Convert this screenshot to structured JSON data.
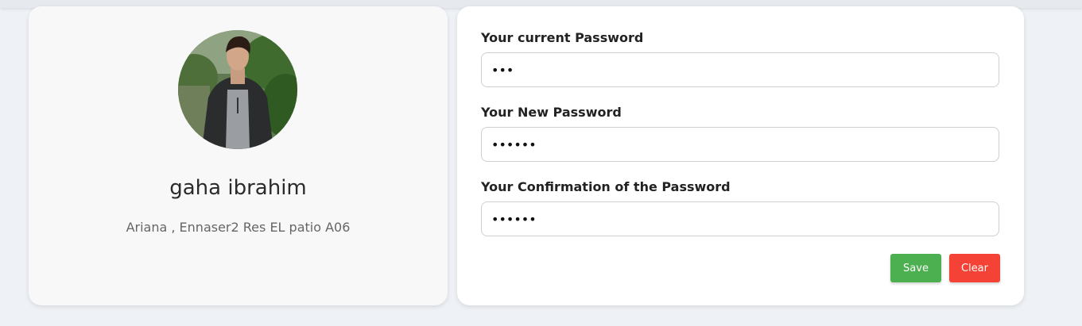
{
  "profile": {
    "name": "gaha ibrahim",
    "address": "Ariana , Ennaser2 Res EL patio A06"
  },
  "password_form": {
    "current": {
      "label": "Your current Password",
      "value": "abc"
    },
    "new": {
      "label": "Your New Password",
      "value": "abcdef"
    },
    "confirm": {
      "label": "Your Confirmation of the Password",
      "value": "abcdef"
    },
    "save_label": "Save",
    "clear_label": "Clear"
  },
  "colors": {
    "save": "#4caf50",
    "clear": "#f44336",
    "page_background": "#eef1f5"
  }
}
